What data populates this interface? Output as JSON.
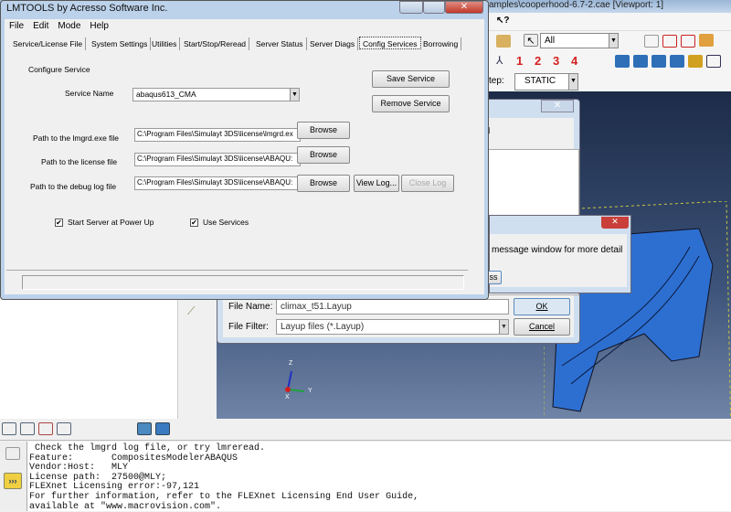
{
  "abaqus": {
    "title": "amples\\cooperhood-6.7-2.cae [Viewport: 1]",
    "selection_filter": "All",
    "step_label": "tep:",
    "step_value": "STATIC",
    "view_numbers": [
      "1",
      "2",
      "3",
      "4"
    ],
    "triad": {
      "z": "Z",
      "y": "Y",
      "x": "X"
    },
    "messages": [
      " Check the lmgrd log file, or try lmreread.",
      "Feature:       CompositesModelerABAQUS",
      "Vendor:Host:   MLY",
      "License path:  27500@MLY;",
      "FLEXnet Licensing error:-97,121",
      "For further information, refer to the FLEXnet Licensing End User Guide,",
      "available at \"www.macrovision.com\"."
    ]
  },
  "file_dialog": {
    "file_name_label": "File Name:",
    "file_name": "climax_t51.Layup",
    "filter_label": "File Filter:",
    "filter": "Layup files (*.Layup)",
    "ok": "OK",
    "cancel": "Cancel"
  },
  "error_dialog": {
    "message": "message window for more detail",
    "button": "ss"
  },
  "lmtools": {
    "title": "LMTOOLS by Acresso Software Inc.",
    "menu": [
      "File",
      "Edit",
      "Mode",
      "Help"
    ],
    "tabs": [
      "Service/License File",
      "System Settings",
      "Utilities",
      "Start/Stop/Reread",
      "Server Status",
      "Server Diags",
      "Config Services",
      "Borrowing"
    ],
    "section": "Configure Service",
    "service_name_label": "Service Name",
    "service_name": "abaqus613_CMA",
    "save": "Save Service",
    "remove": "Remove Service",
    "lmgrd_label": "Path to the lmgrd.exe file",
    "lmgrd_path": "C:\\Program Files\\Simulayt 3DS\\license\\lmgrd.ex",
    "license_label": "Path to the license file",
    "license_path": "C:\\Program Files\\Simulayt 3DS\\license\\ABAQU:",
    "log_label": "Path to the debug log file",
    "log_path": "C:\\Program Files\\Simulayt 3DS\\license\\ABAQU:",
    "browse": "Browse",
    "view_log": "View Log...",
    "close_log": "Close Log",
    "start_server": "Start Server at Power Up",
    "use_services": "Use Services",
    "start_server_checked": true,
    "use_services_checked": true
  }
}
